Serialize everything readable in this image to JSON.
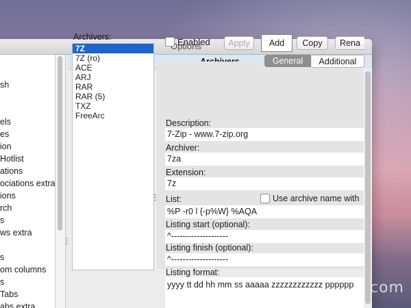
{
  "window": {
    "title": "Options"
  },
  "left_list": {
    "items": [
      "sh",
      "",
      "",
      "els",
      "es",
      "ion",
      "Hotlist",
      "ations",
      "ociations extra",
      "ions",
      "rch",
      "s",
      "ws extra",
      "",
      "s",
      "om columns",
      "s",
      "Tabs",
      "abs extra"
    ]
  },
  "panel_title": "Archivers",
  "archivers": {
    "label": "Archivers:",
    "items": [
      "7Z",
      "7Z (ro)",
      "ACE",
      "ARJ",
      "RAR",
      "RAR (5)",
      "TXZ",
      "FreeArc"
    ],
    "selected_index": 0
  },
  "toolbar": {
    "enabled_label": "Enabled",
    "apply_label": "Apply",
    "add_label": "Add",
    "copy_label": "Copy",
    "rename_label": "Rena"
  },
  "tabs": {
    "general": "General",
    "additional": "Additional"
  },
  "form": {
    "description_label": "Description:",
    "description_value": "7-Zip - www.7-zip.org",
    "archiver_label": "Archiver:",
    "archiver_value": "7za",
    "extension_label": "Extension:",
    "extension_value": "7z",
    "list_label": "List:",
    "list_value": "%P -r0 l {-p%W} %AQA",
    "use_archive_name_label": "Use archive name with",
    "listing_start_label": "Listing start (optional):",
    "listing_start_value": "^--------------------",
    "listing_finish_label": "Listing finish (optional):",
    "listing_finish_value": "^--------------------",
    "listing_format_label": "Listing format:",
    "listing_format_value": "yyyy tt dd hh mm ss aaaaa zzzzzzzzzzzz pppppp"
  },
  "watermark": "com",
  "colors": {
    "selection": "#1f64c8",
    "header": "#d8e8f5",
    "segment_selected": "#8e8e8e"
  }
}
